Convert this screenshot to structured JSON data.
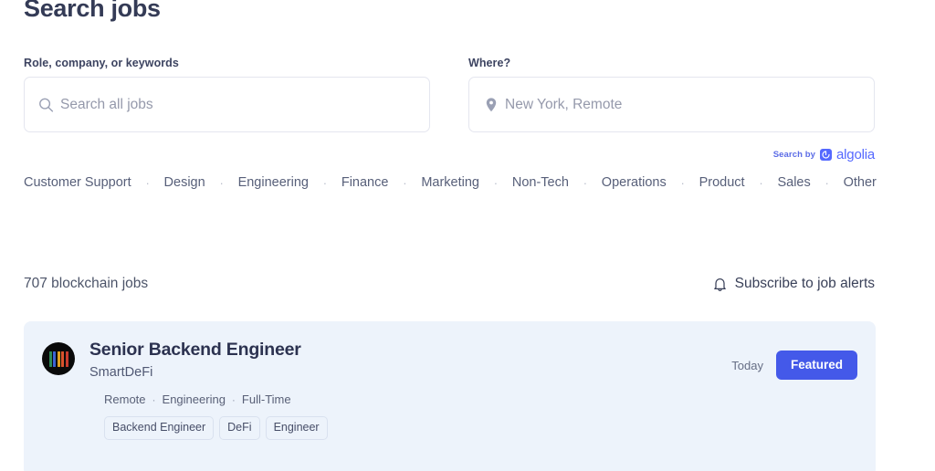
{
  "header": {
    "title": "Search jobs"
  },
  "search": {
    "keyword_field": {
      "label": "Role, company, or keywords",
      "placeholder": "Search all jobs",
      "value": "",
      "icon": "search-icon"
    },
    "location_field": {
      "label": "Where?",
      "placeholder": "New York, Remote",
      "value": "",
      "icon": "map-pin-icon"
    },
    "attribution": {
      "prefix": "Search by",
      "brand": "algolia",
      "brand_color": "#5468ff"
    }
  },
  "categories": {
    "separator": "·",
    "items": [
      {
        "label": "Customer Support"
      },
      {
        "label": "Design"
      },
      {
        "label": "Engineering"
      },
      {
        "label": "Finance"
      },
      {
        "label": "Marketing"
      },
      {
        "label": "Non-Tech"
      },
      {
        "label": "Operations"
      },
      {
        "label": "Product"
      },
      {
        "label": "Sales"
      },
      {
        "label": "Other"
      }
    ]
  },
  "results": {
    "count_label": "707 blockchain jobs",
    "subscribe_label": "Subscribe to job alerts",
    "subscribe_icon": "bell-icon"
  },
  "jobs": [
    {
      "title": "Senior Backend Engineer",
      "company": "SmartDeFi",
      "date": "Today",
      "badge": "Featured",
      "badge_color": "#4459e9",
      "card_background": "#edf3fb",
      "logo": {
        "name": "smartdefi-logo",
        "background": "#0a0a0a",
        "bars": [
          "#2e8b57",
          "#3b62d4",
          "#e0a020",
          "#d9532c",
          "#c93b2e"
        ]
      },
      "meta": [
        "Remote",
        "Engineering",
        "Full-Time"
      ],
      "meta_separator": "·",
      "tags": [
        "Backend Engineer",
        "DeFi",
        "Engineer"
      ]
    }
  ]
}
